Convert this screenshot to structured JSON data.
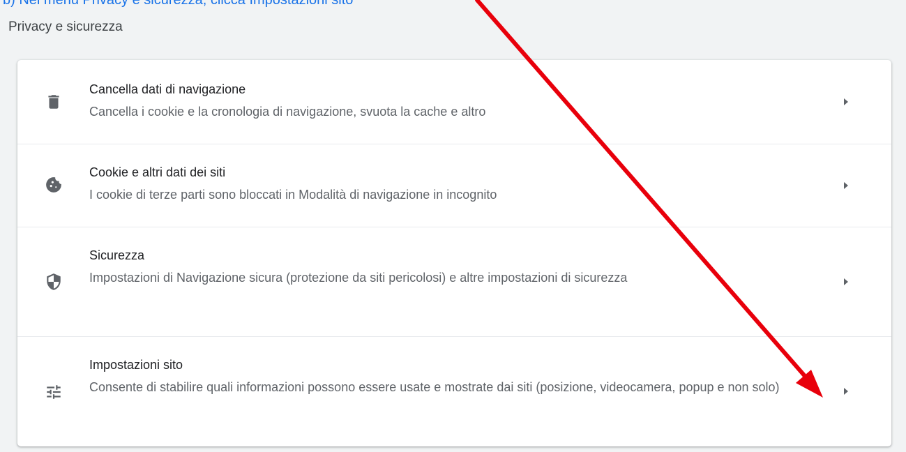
{
  "header": {
    "caption": "b) Nel menu Privacy e sicurezza, clicca Impostazioni sito"
  },
  "section": {
    "title": "Privacy e sicurezza"
  },
  "items": [
    {
      "icon": "trash-icon",
      "title": "Cancella dati di navigazione",
      "description": "Cancella i cookie e la cronologia di navigazione, svuota la cache e altro"
    },
    {
      "icon": "cookie-icon",
      "title": "Cookie e altri dati dei siti",
      "description": "I cookie di terze parti sono bloccati in Modalità di navigazione in incognito"
    },
    {
      "icon": "shield-icon",
      "title": "Sicurezza",
      "description": "Impostazioni di Navigazione sicura (protezione da siti pericolosi) e altre impostazioni di sicurezza"
    },
    {
      "icon": "tune-icon",
      "title": "Impostazioni sito",
      "description": "Consente di stabilire quali informazioni possono essere usate e mostrate dai siti (posizione, videocamera, popup e non solo)"
    }
  ],
  "colors": {
    "accent": "#1a73e8",
    "annotation_arrow": "#e8000b",
    "icon": "#5f6368"
  }
}
